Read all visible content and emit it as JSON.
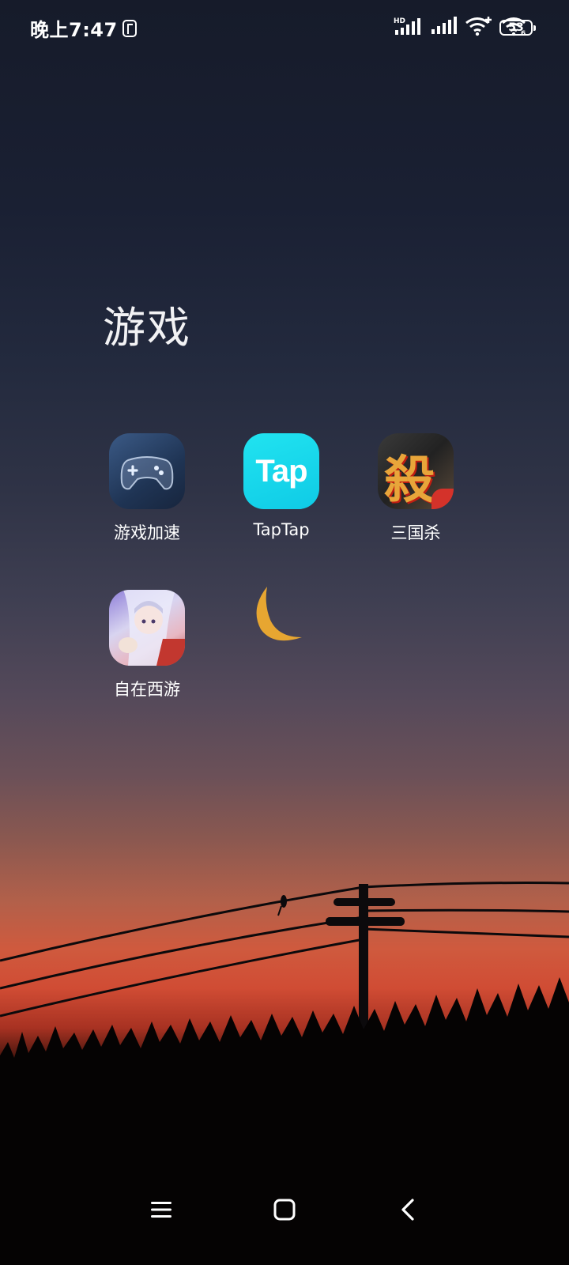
{
  "status_bar": {
    "time": "晚上7:47",
    "network_badge": "HD",
    "battery_level": "53",
    "icons": [
      "nfc-icon",
      "hd-signal-icon",
      "signal-icon",
      "wifi-plus-icon",
      "wifi-6-icon",
      "battery-icon"
    ]
  },
  "folder": {
    "title": "游戏",
    "apps": [
      {
        "name": "游戏加速",
        "icon": "gamepad-icon"
      },
      {
        "name": "TapTap",
        "icon": "taptap-icon",
        "icon_text": "Tap"
      },
      {
        "name": "三国杀",
        "icon": "sanguosha-icon",
        "icon_text": "殺"
      },
      {
        "name": "自在西游",
        "icon": "zizaixiyou-icon"
      }
    ]
  },
  "wallpaper": {
    "moon_color": "#e7a631",
    "sky_top": "#161b2a",
    "sunset": "#d04c34"
  },
  "nav_bar": {
    "buttons": [
      "menu-button",
      "home-button",
      "back-button"
    ]
  }
}
